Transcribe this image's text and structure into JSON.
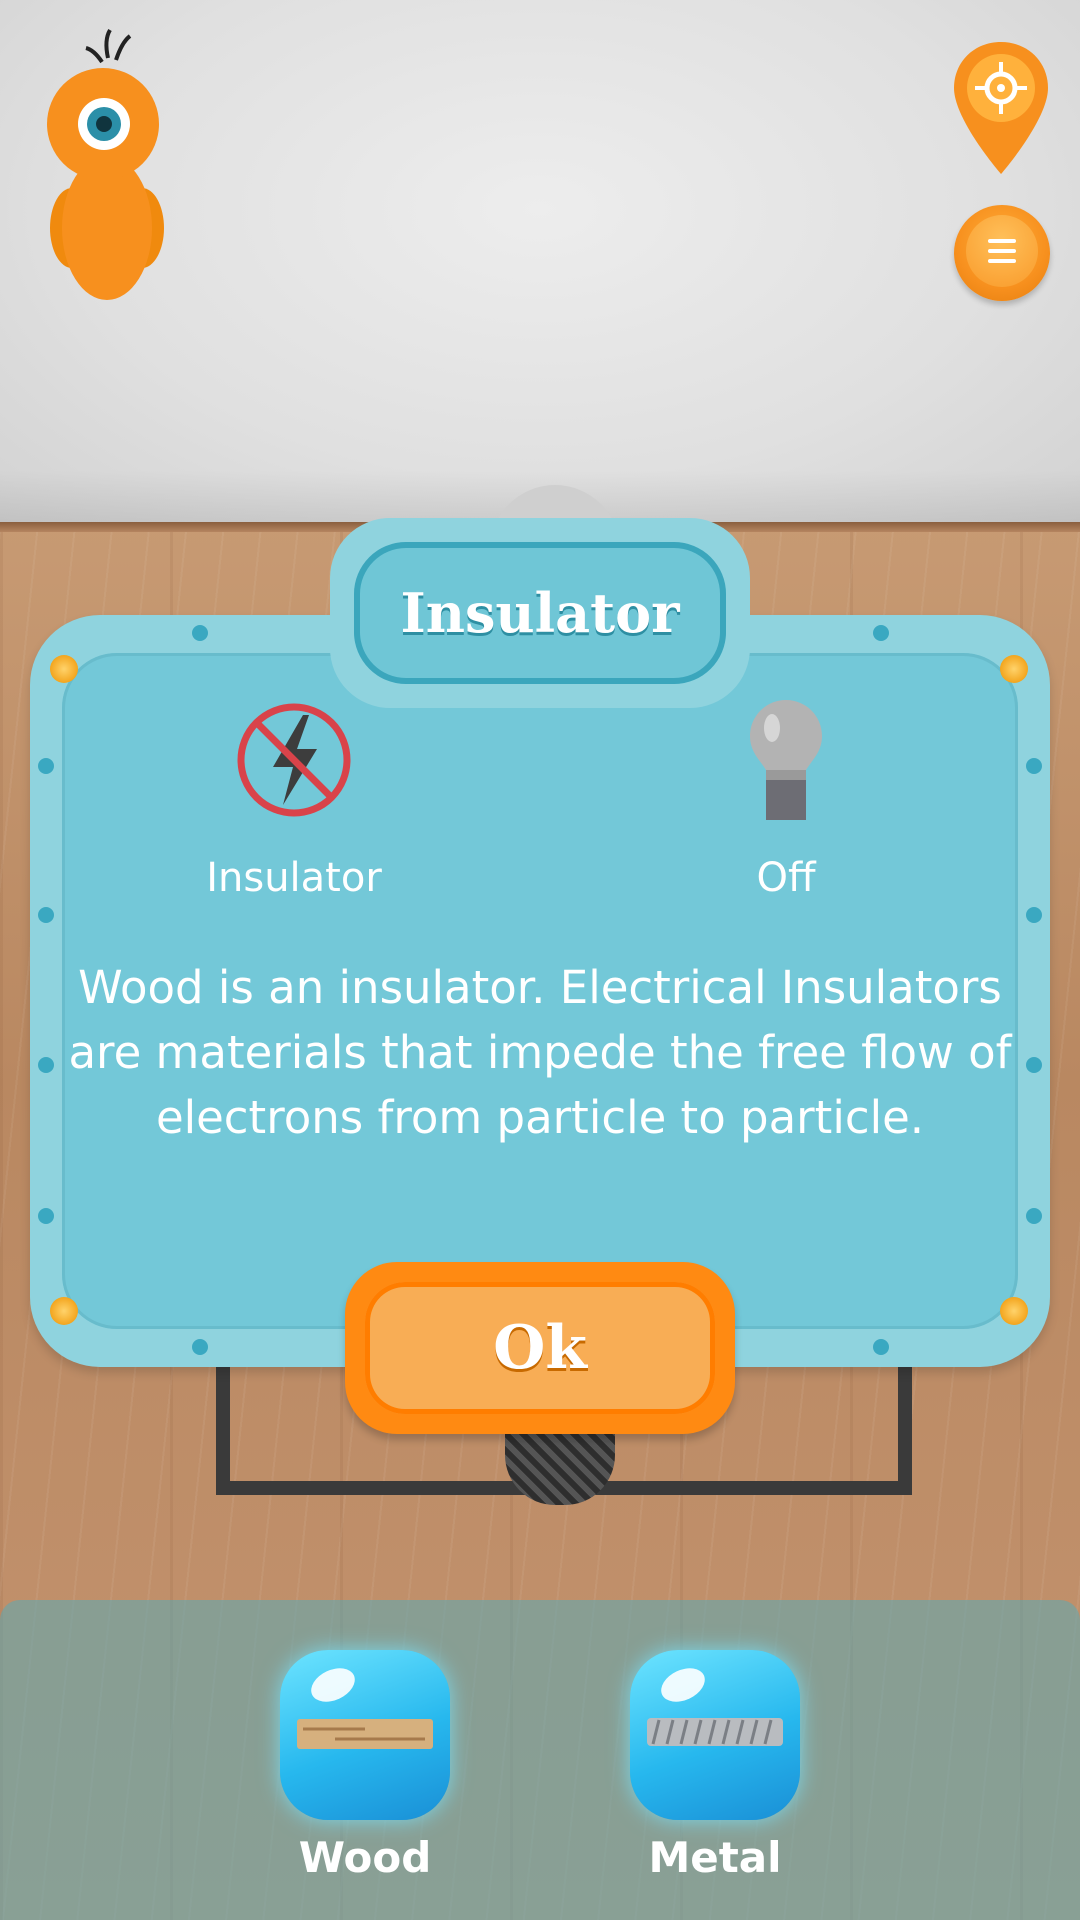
{
  "modal": {
    "title": "Insulator",
    "conductivity_label": "Insulator",
    "bulb_state_label": "Off",
    "description": "Wood is an insulator. Electrical Insulators are materials that impede the free flow of electrons from particle to particle.",
    "ok_label": "Ok"
  },
  "materials": [
    {
      "label": "Wood"
    },
    {
      "label": "Metal"
    }
  ],
  "icons": {
    "mascot": "one-eyed-orange-creature",
    "locate": "location-pin-icon",
    "menu": "hamburger-menu-icon",
    "insulator": "no-electricity-icon",
    "bulb": "light-bulb-off-icon"
  },
  "colors": {
    "accent_orange": "#f7901e",
    "panel_blue": "#73c8d8"
  }
}
